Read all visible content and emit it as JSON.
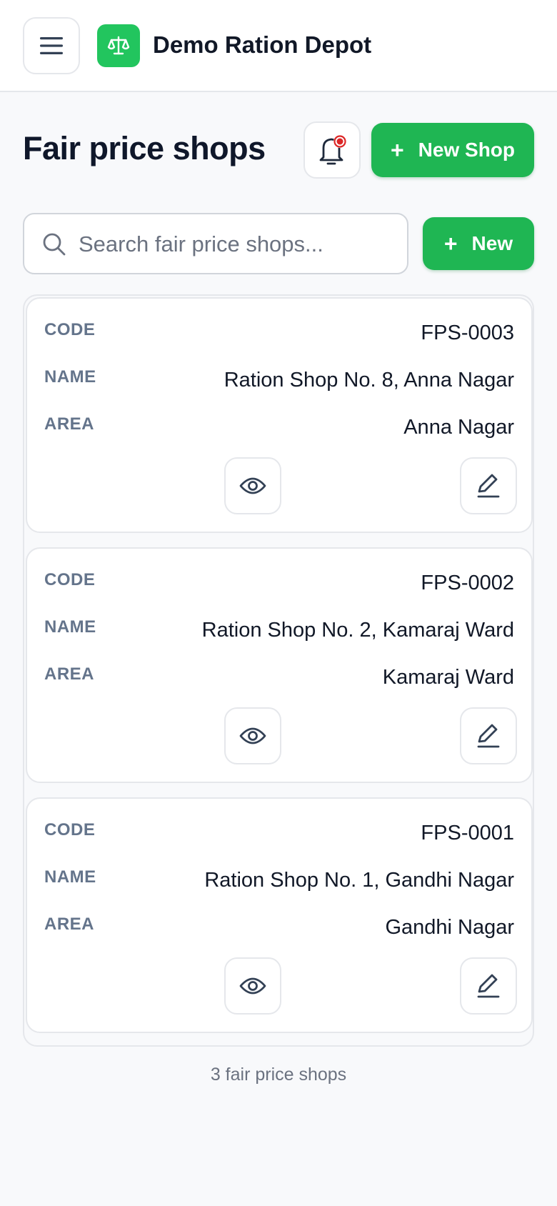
{
  "app": {
    "title": "Demo Ration Depot",
    "logo_icon": "scale-icon",
    "brand_color": "#22c55e"
  },
  "header": {
    "title": "Fair price shops",
    "new_shop_label": "New Shop",
    "notification_badge_color": "#dc2626"
  },
  "search": {
    "placeholder": "Search fair price shops...",
    "value": "",
    "new_label": "New"
  },
  "fields": {
    "code_label": "CODE",
    "name_label": "NAME",
    "area_label": "AREA"
  },
  "shops": [
    {
      "code": "FPS-0003",
      "name": "Ration Shop No. 8, Anna Nagar",
      "area": "Anna Nagar"
    },
    {
      "code": "FPS-0002",
      "name": "Ration Shop No. 2, Kamaraj Ward",
      "area": "Kamaraj Ward"
    },
    {
      "code": "FPS-0001",
      "name": "Ration Shop No. 1, Gandhi Nagar",
      "area": "Gandhi Nagar"
    }
  ],
  "footer": {
    "count_text": "3 fair price shops"
  }
}
